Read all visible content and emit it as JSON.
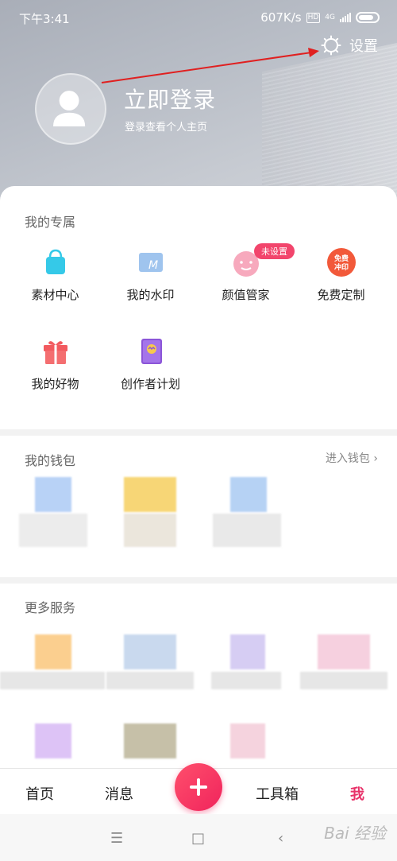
{
  "status": {
    "time": "下午3:41",
    "speed": "607K/s",
    "hd": "HD",
    "network": "4G"
  },
  "header": {
    "settings_label": "设置",
    "login_title": "立即登录",
    "login_sub": "登录查看个人主页"
  },
  "exclusive": {
    "title": "我的专属",
    "badge": "未设置",
    "promo_text": "免费\n冲印",
    "items": [
      {
        "label": "素材中心",
        "icon": "shopping-bag-icon",
        "color": "#35c9e8"
      },
      {
        "label": "我的水印",
        "icon": "watermark-icon",
        "color": "#9fc4ee"
      },
      {
        "label": "颜值管家",
        "icon": "face-icon",
        "color": "#f7a9bd"
      },
      {
        "label": "免费定制",
        "icon": "free-print-icon",
        "color": "#f2593a"
      },
      {
        "label": "我的好物",
        "icon": "gift-icon",
        "color": "#f25a5f"
      },
      {
        "label": "创作者计划",
        "icon": "creator-book-icon",
        "color": "#8b55d8"
      }
    ]
  },
  "wallet": {
    "title": "我的钱包",
    "enter": "进入钱包 ›"
  },
  "more": {
    "title": "更多服务",
    "partial_labels": [
      "每日一测",
      "漫画大全",
      "魅惑AI美颜"
    ]
  },
  "tabs": {
    "home": "首页",
    "messages": "消息",
    "toolbox": "工具箱",
    "me": "我"
  },
  "nav": {
    "menu": "☰",
    "home": "□",
    "back": "‹"
  },
  "watermark": "Bai 经验",
  "colors": {
    "accent": "#e8336a",
    "annotation": "#e02020"
  }
}
